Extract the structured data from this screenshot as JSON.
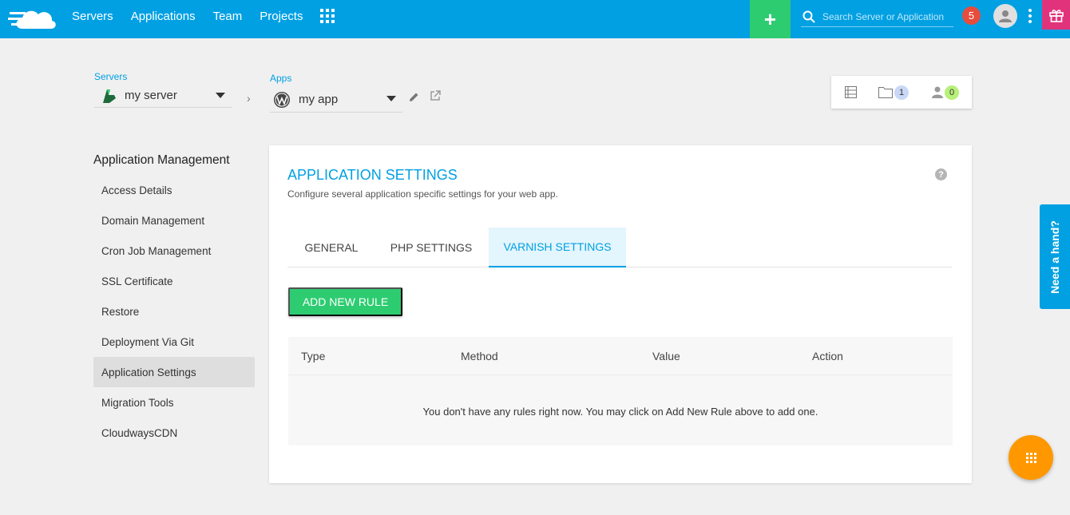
{
  "topbar": {
    "nav": [
      "Servers",
      "Applications",
      "Team",
      "Projects"
    ],
    "search_placeholder": "Search Server or Application",
    "notification_count": "5"
  },
  "breadcrumb": {
    "servers_label": "Servers",
    "server_name": "my server",
    "apps_label": "Apps",
    "app_name": "my app"
  },
  "counts": {
    "folders": "1",
    "members": "0"
  },
  "sidebar": {
    "title": "Application Management",
    "items": [
      "Access Details",
      "Domain Management",
      "Cron Job Management",
      "SSL Certificate",
      "Restore",
      "Deployment Via Git",
      "Application Settings",
      "Migration Tools",
      "CloudwaysCDN"
    ],
    "active": "Application Settings"
  },
  "panel": {
    "title": "APPLICATION SETTINGS",
    "subtitle": "Configure several application specific settings for your web app.",
    "help": "?",
    "tabs": [
      "GENERAL",
      "PHP SETTINGS",
      "VARNISH SETTINGS"
    ],
    "active_tab": "VARNISH SETTINGS",
    "add_button": "ADD NEW RULE",
    "table_headers": [
      "Type",
      "Method",
      "Value",
      "Action"
    ],
    "empty_message": "You don't have any rules right now. You may click on Add New Rule above to add one."
  },
  "floating": {
    "need_hand": "Need a hand?"
  },
  "colors": {
    "primary": "#00a0e3",
    "green": "#2ecc71",
    "orange": "#ff9800",
    "notification": "#e74c3c",
    "gift": "#e0337b"
  }
}
